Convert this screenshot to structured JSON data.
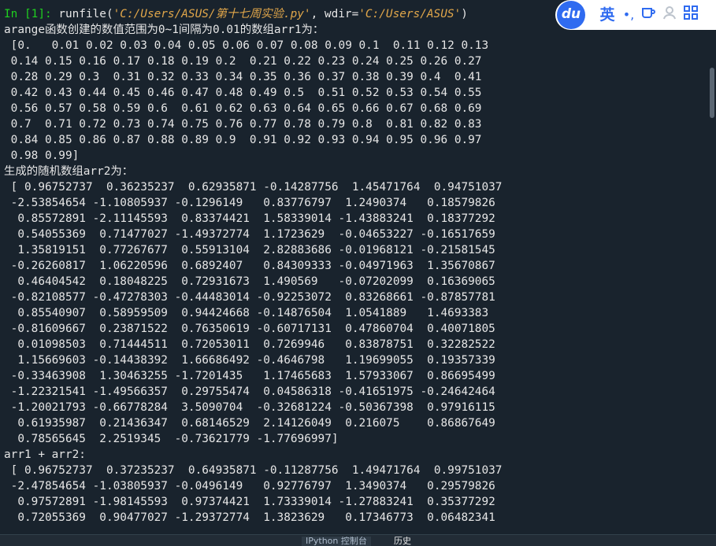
{
  "console": {
    "input_prompt": "In [1]: ",
    "command_prefix": "runfile(",
    "file_path": "'C:/Users/ASUS/第十七周实验.py'",
    "command_mid": ", wdir=",
    "wdir_path": "'C:/Users/ASUS'",
    "command_suffix": ")",
    "output_lines": [
      "arange函数创建的数值范围为0~1间隔为0.01的数组arr1为：",
      " [0.   0.01 0.02 0.03 0.04 0.05 0.06 0.07 0.08 0.09 0.1  0.11 0.12 0.13",
      " 0.14 0.15 0.16 0.17 0.18 0.19 0.2  0.21 0.22 0.23 0.24 0.25 0.26 0.27",
      " 0.28 0.29 0.3  0.31 0.32 0.33 0.34 0.35 0.36 0.37 0.38 0.39 0.4  0.41",
      " 0.42 0.43 0.44 0.45 0.46 0.47 0.48 0.49 0.5  0.51 0.52 0.53 0.54 0.55",
      " 0.56 0.57 0.58 0.59 0.6  0.61 0.62 0.63 0.64 0.65 0.66 0.67 0.68 0.69",
      " 0.7  0.71 0.72 0.73 0.74 0.75 0.76 0.77 0.78 0.79 0.8  0.81 0.82 0.83",
      " 0.84 0.85 0.86 0.87 0.88 0.89 0.9  0.91 0.92 0.93 0.94 0.95 0.96 0.97",
      " 0.98 0.99]",
      "生成的随机数组arr2为：",
      " [ 0.96752737  0.36235237  0.62935871 -0.14287756  1.45471764  0.94751037",
      " -2.53854654 -1.10805937 -0.1296149   0.83776797  1.2490374   0.18579826",
      "  0.85572891 -2.11145593  0.83374421  1.58339014 -1.43883241  0.18377292",
      "  0.54055369  0.71477027 -1.49372774  1.1723629  -0.04653227 -0.16517659",
      "  1.35819151  0.77267677  0.55913104  2.82883686 -0.01968121 -0.21581545",
      " -0.26260817  1.06220596  0.6892407   0.84309333 -0.04971963  1.35670867",
      "  0.46404542  0.18048225  0.72931673  1.490569   -0.07202099  0.16369065",
      " -0.82108577 -0.47278303 -0.44483014 -0.92253072  0.83268661 -0.87857781",
      "  0.85540907  0.58959509  0.94424668 -0.14876504  1.0541889   1.4693383",
      " -0.81609667  0.23871522  0.76350619 -0.60717131  0.47860704  0.40071805",
      "  0.01098503  0.71444511  0.72053011  0.7269946   0.83878751  0.32282522",
      "  1.15669603 -0.14438392  1.66686492 -0.4646798   1.19699055  0.19357339",
      " -0.33463908  1.30463255 -1.7201435   1.17465683  1.57933067  0.86695499",
      " -1.22321541 -1.49566357  0.29755474  0.04586318 -0.41651975 -0.24642464",
      " -1.20021793 -0.66778284  3.5090704  -0.32681224 -0.50367398  0.97916115",
      "  0.61935987  0.21436347  0.68146529  2.14126049  0.216075    0.86867649",
      "  0.78565645  2.2519345  -0.73621779 -1.77696997]",
      "arr1 + arr2:",
      " [ 0.96752737  0.37235237  0.64935871 -0.11287756  1.49471764  0.99751037",
      " -2.47854654 -1.03805937 -0.0496149   0.92776797  1.3490374   0.29579826",
      "  0.97572891 -1.98145593  0.97374421  1.73339014 -1.27883241  0.35377292",
      "  0.72055369  0.90477027 -1.29372774  1.3823629   0.17346773  0.06482341"
    ]
  },
  "bottom_tabs": [
    {
      "label": "IPython 控制台"
    },
    {
      "label": "历史"
    }
  ],
  "ime": {
    "logo": "du",
    "language": "英",
    "punctuation": "•,",
    "icons": [
      "cup-icon",
      "user-icon",
      "grid-icon"
    ]
  },
  "colors": {
    "background": "#19232d",
    "prompt": "#1fd01f",
    "string": "#e0a64a",
    "text": "#e6e6e6",
    "ime_accent": "#2f6bf0"
  }
}
